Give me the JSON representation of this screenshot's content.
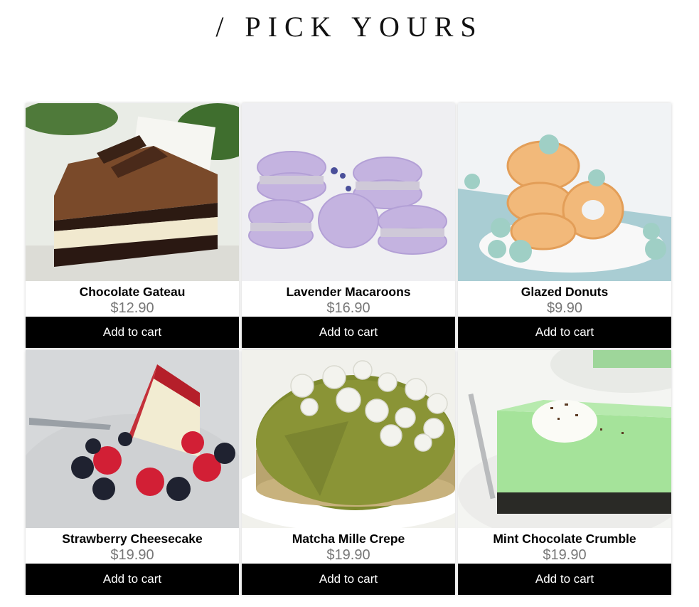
{
  "header": {
    "title": "/ PICK YOURS"
  },
  "products": [
    {
      "name": "Chocolate Gateau",
      "price": "$12.90",
      "cart_label": "Add to cart",
      "image": "chocolate-gateau-photo"
    },
    {
      "name": "Lavender Macaroons",
      "price": "$16.90",
      "cart_label": "Add to cart",
      "image": "lavender-macaroons-photo"
    },
    {
      "name": "Glazed Donuts",
      "price": "$9.90",
      "cart_label": "Add to cart",
      "image": "glazed-donuts-photo"
    },
    {
      "name": "Strawberry Cheesecake",
      "price": "$19.90",
      "cart_label": "Add to cart",
      "image": "strawberry-cheesecake-photo"
    },
    {
      "name": "Matcha Mille Crepe",
      "price": "$19.90",
      "cart_label": "Add to cart",
      "image": "matcha-mille-crepe-photo"
    },
    {
      "name": "Mint Chocolate Crumble",
      "price": "$19.90",
      "cart_label": "Add to cart",
      "image": "mint-chocolate-crumble-photo"
    }
  ],
  "colors": {
    "button_bg": "#000000",
    "button_text": "#ffffff",
    "price_text": "#777777"
  }
}
